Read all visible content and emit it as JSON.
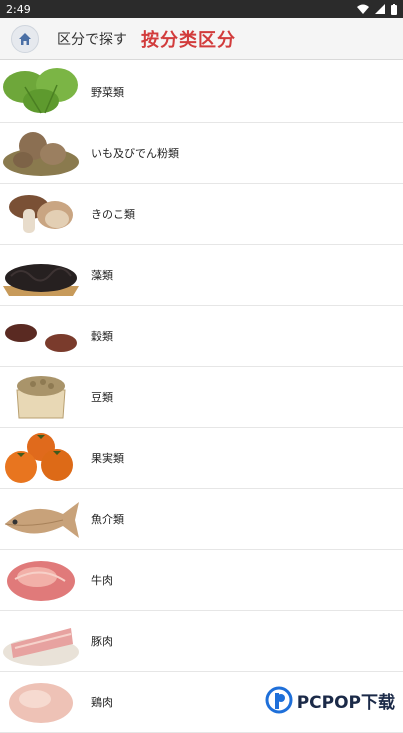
{
  "status": {
    "time": "2:49"
  },
  "header": {
    "sub_label": "区分で探す",
    "title": "按分类区分"
  },
  "items": [
    {
      "label": "野菜類",
      "icon": "vegetable-leaf-icon"
    },
    {
      "label": "いも及びでん粉類",
      "icon": "potato-icon"
    },
    {
      "label": "きのこ類",
      "icon": "mushroom-icon"
    },
    {
      "label": "藻類",
      "icon": "seaweed-icon"
    },
    {
      "label": "穀類",
      "icon": "grain-icon"
    },
    {
      "label": "豆類",
      "icon": "soybean-icon"
    },
    {
      "label": "果実類",
      "icon": "persimmon-icon"
    },
    {
      "label": "魚介類",
      "icon": "fish-icon"
    },
    {
      "label": "牛肉",
      "icon": "beef-icon"
    },
    {
      "label": "豚肉",
      "icon": "pork-icon"
    },
    {
      "label": "鶏肉",
      "icon": "chicken-icon"
    }
  ],
  "watermark": {
    "text": "PCPOP下载"
  },
  "colors": {
    "title": "#d23c3c",
    "header_bg": "#f5f5f5",
    "status_bg": "#2b2b2b"
  }
}
